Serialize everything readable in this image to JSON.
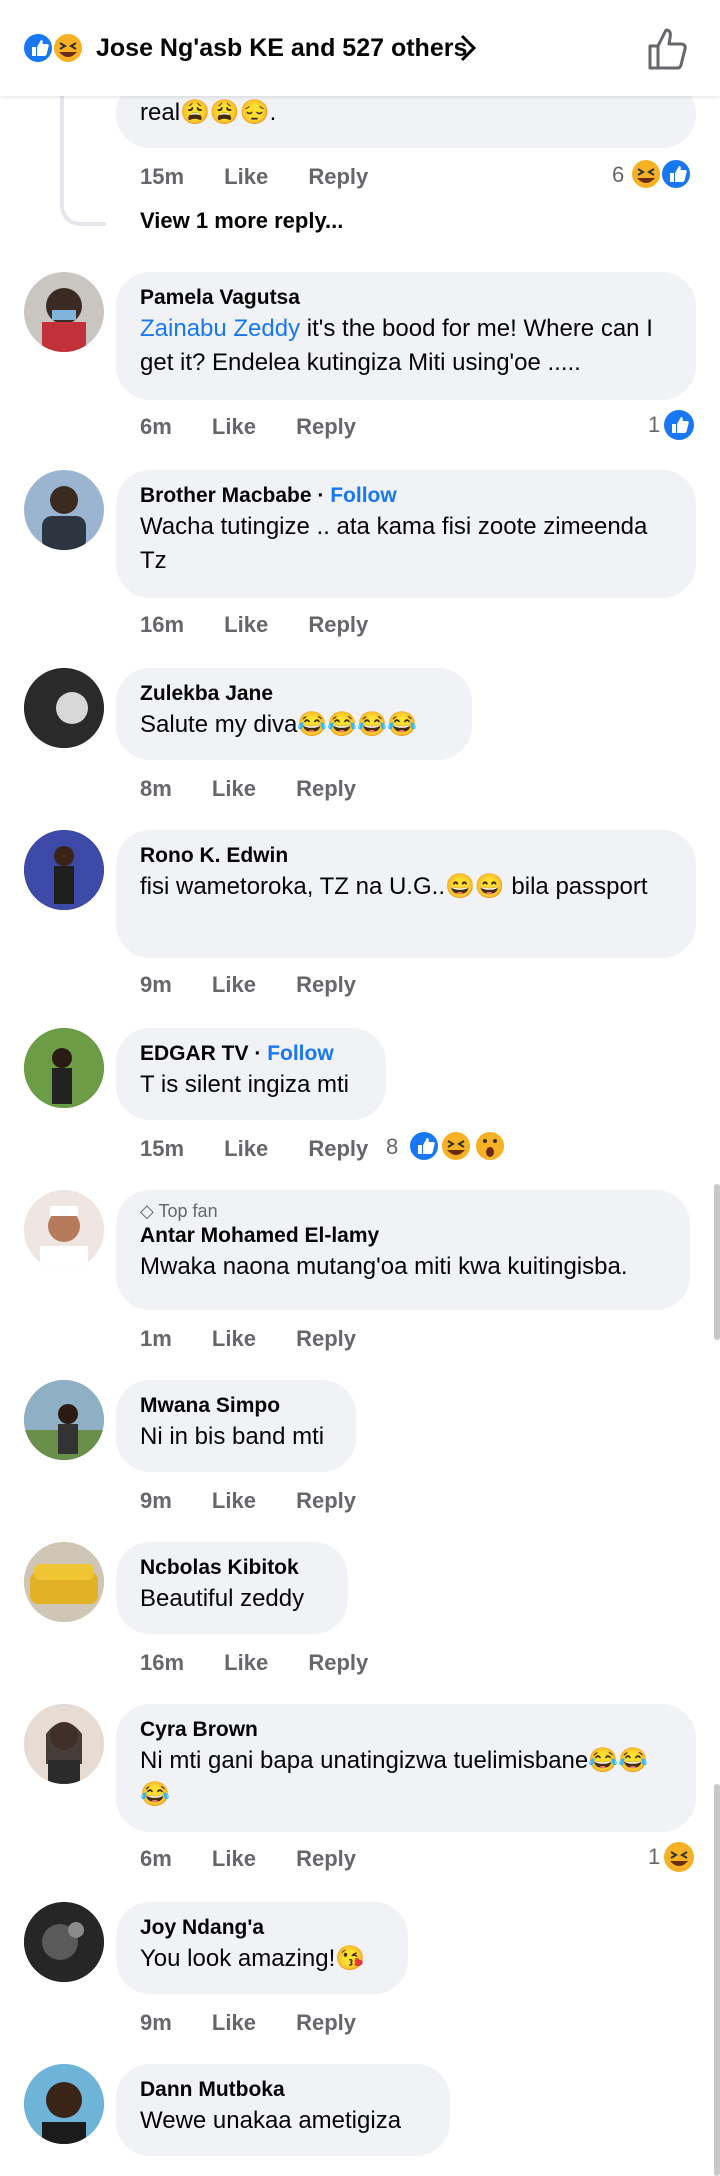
{
  "header": {
    "reactors": "Jose Ng'asb KE and 527 others"
  },
  "thread_tail": {
    "text_end": "real😩😩😔.",
    "time": "15m",
    "like": "Like",
    "reply": "Reply",
    "reaction_count": "6",
    "view_more": "View 1 more reply..."
  },
  "comments": [
    {
      "name": "Pamela Vagutsa",
      "mention": "Zainabu Zeddy",
      "text": " it's the bood for me! Where can I get it? Endelea kutingiza Miti using'oe .....",
      "time": "6m",
      "like": "Like",
      "reply": "Reply",
      "reaction_count": "1"
    },
    {
      "name": "Brother Macbabe",
      "follow": "Follow",
      "text": "Wacha tutingize .. ata kama fisi zoote zimeenda Tz",
      "time": "16m",
      "like": "Like",
      "reply": "Reply"
    },
    {
      "name": "Zulekba Jane",
      "text": "Salute my diva😂😂😂😂",
      "time": "8m",
      "like": "Like",
      "reply": "Reply"
    },
    {
      "name": "Rono K. Edwin",
      "text": "fisi wametoroka, TZ na U.G..😄😄 bila passport",
      "time": "9m",
      "like": "Like",
      "reply": "Reply"
    },
    {
      "name": "EDGAR TV",
      "follow": "Follow",
      "text": "T is silent ingiza mti",
      "time": "15m",
      "like": "Like",
      "reply": "Reply",
      "reaction_count": "8"
    },
    {
      "name": "Antar Mohamed El-lamy",
      "badge": "Top fan",
      "text": "Mwaka naona mutang'oa miti kwa kuitingisba.",
      "time": "1m",
      "like": "Like",
      "reply": "Reply"
    },
    {
      "name": "Mwana Simpo",
      "text": "Ni in bis band mti",
      "time": "9m",
      "like": "Like",
      "reply": "Reply"
    },
    {
      "name": "Ncbolas Kibitok",
      "text": "Beautiful zeddy",
      "time": "16m",
      "like": "Like",
      "reply": "Reply"
    },
    {
      "name": "Cyra Brown",
      "text": "Ni mti gani bapa unatingizwa tuelimisbane😂😂😂",
      "time": "6m",
      "like": "Like",
      "reply": "Reply",
      "reaction_count": "1"
    },
    {
      "name": "Joy Ndang'a",
      "text": "You look amazing!😘",
      "time": "9m",
      "like": "Like",
      "reply": "Reply"
    },
    {
      "name": "Dann Mutboka",
      "text": "Wewe unakaa ametigiza"
    }
  ],
  "colors": {
    "accent": "#1877f2",
    "bubble": "#f0f2f5",
    "meta": "#65676b"
  }
}
